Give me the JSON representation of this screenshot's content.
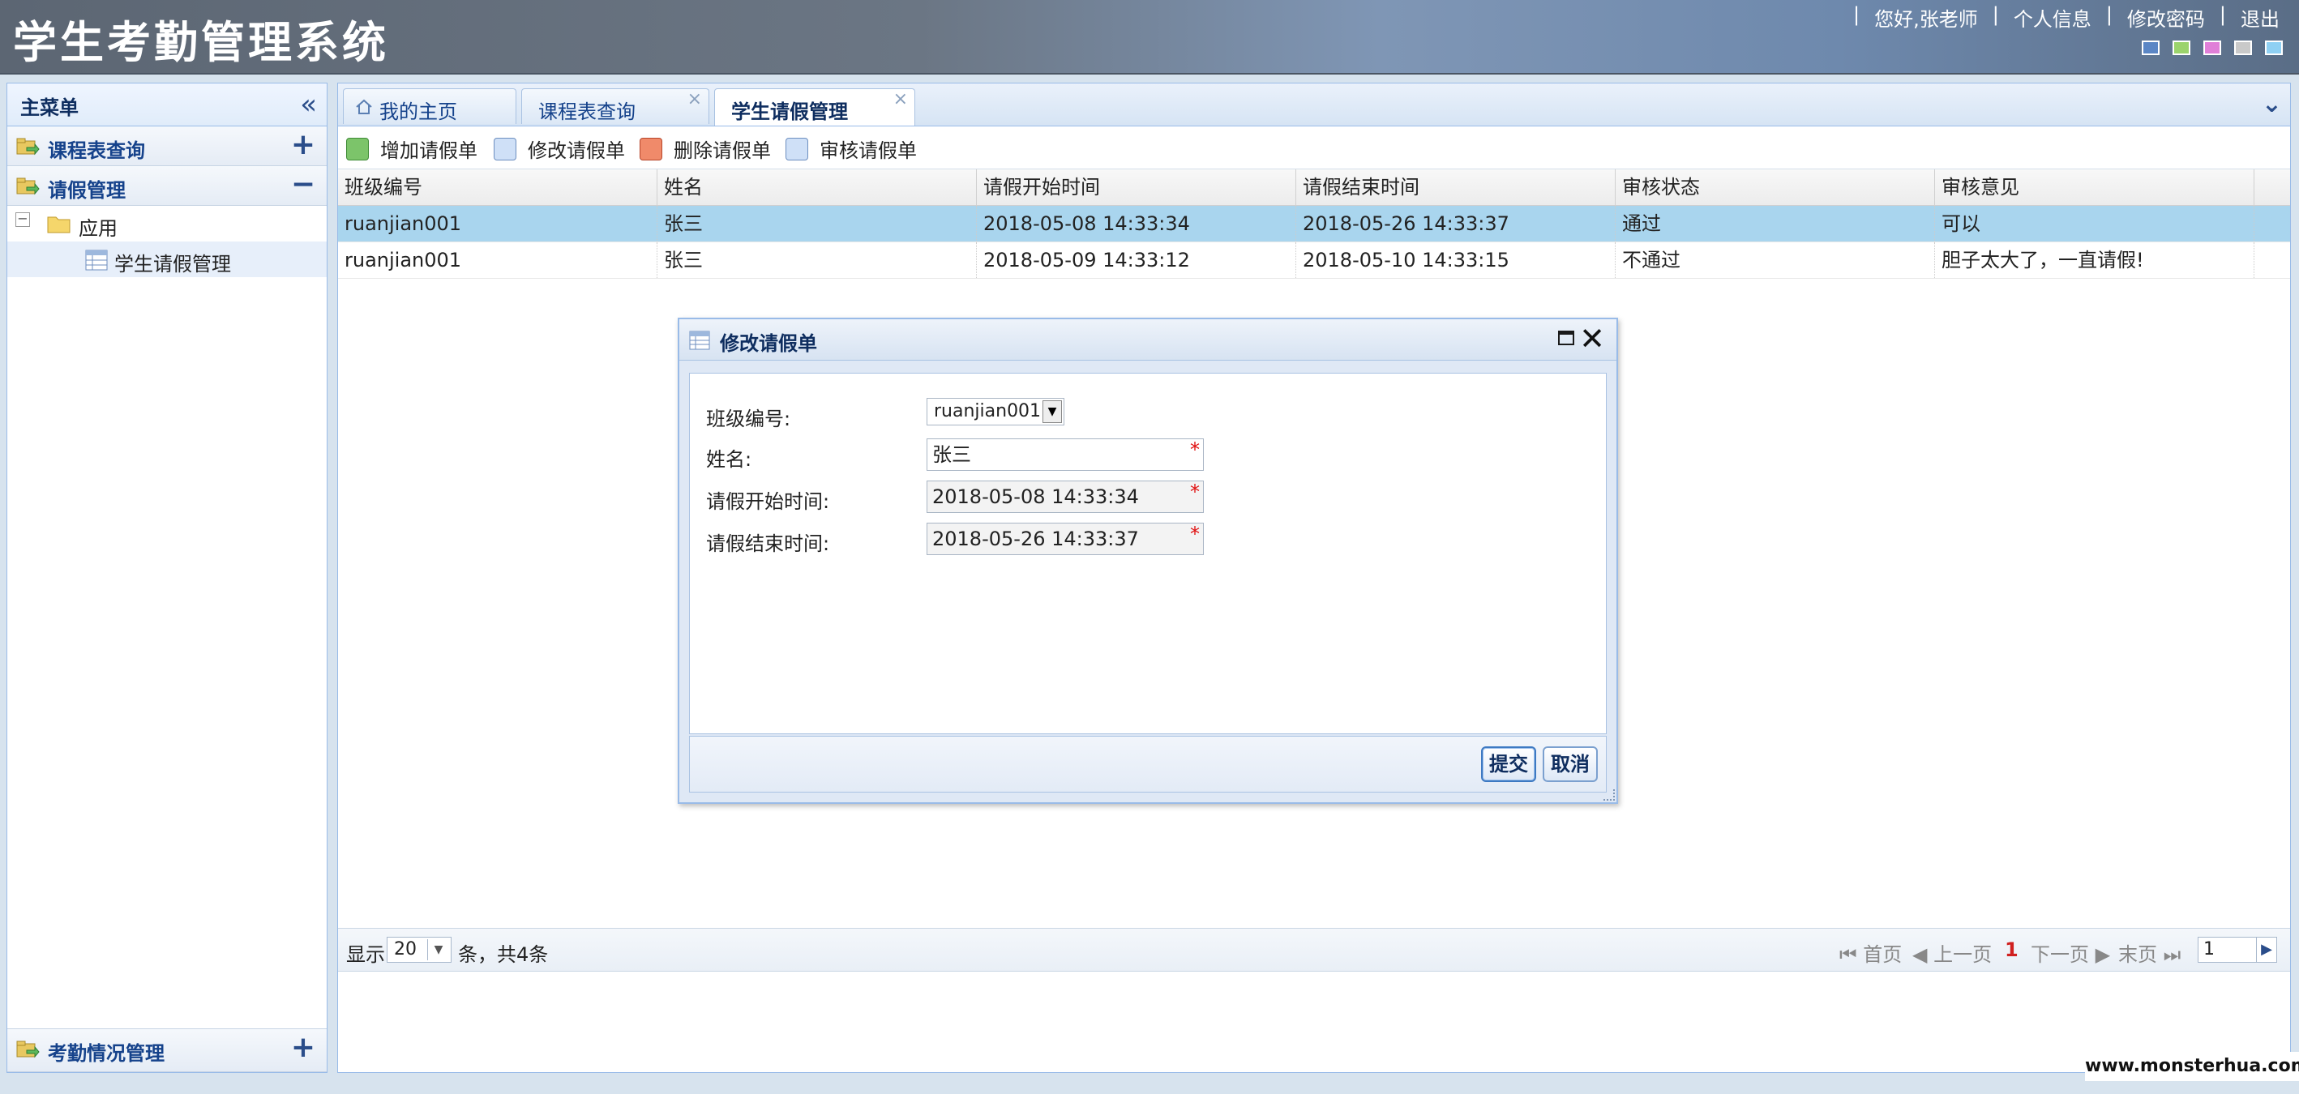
{
  "app": {
    "title": "学生考勤管理系统"
  },
  "top_links": {
    "greeting": "您好,张老师",
    "profile": "个人信息",
    "change_password": "修改密码",
    "logout": "退出"
  },
  "themes": [
    "#5b86c5",
    "#9bd36c",
    "#e07fd8",
    "#c9c9c9",
    "#8fd0f3"
  ],
  "sidebar": {
    "title": "主菜单",
    "sections": [
      {
        "label": "课程表查询",
        "toggle": "+"
      },
      {
        "label": "请假管理",
        "toggle": "−"
      }
    ],
    "tree": {
      "folder": "应用",
      "leaf": "学生请假管理",
      "expander": "−"
    },
    "bottom_section": {
      "label": "考勤情况管理",
      "toggle": "+"
    }
  },
  "tabs": [
    {
      "label": "我的主页",
      "closable": false
    },
    {
      "label": "课程表查询",
      "closable": true
    },
    {
      "label": "学生请假管理",
      "closable": true,
      "active": true
    }
  ],
  "toolbar": {
    "add": "增加请假单",
    "edit": "修改请假单",
    "delete": "删除请假单",
    "review": "审核请假单"
  },
  "grid": {
    "columns": [
      "班级编号",
      "姓名",
      "请假开始时间",
      "请假结束时间",
      "审核状态",
      "审核意见"
    ],
    "rows": [
      [
        "ruanjian001",
        "张三",
        "2018-05-08 14:33:34",
        "2018-05-26 14:33:37",
        "通过",
        "可以"
      ],
      [
        "ruanjian001",
        "张三",
        "2018-05-09 14:33:12",
        "2018-05-10 14:33:15",
        "不通过",
        "胆子太大了，一直请假!"
      ]
    ],
    "selected_row": 0
  },
  "pager": {
    "show_label": "显示",
    "page_size": "20",
    "total_label": "条，共4条",
    "first": "首页",
    "prev": "上一页",
    "current": "1",
    "next": "下一页",
    "last": "末页",
    "page_input": "1"
  },
  "dialog": {
    "title": "修改请假单",
    "fields": {
      "class_label": "班级编号:",
      "class_value": "ruanjian001",
      "name_label": "姓名:",
      "name_value": "张三",
      "start_label": "请假开始时间:",
      "start_value": "2018-05-08 14:33:34",
      "end_label": "请假结束时间:",
      "end_value": "2018-05-26 14:33:37",
      "required_mark": "*"
    },
    "submit": "提交",
    "cancel": "取消"
  },
  "watermark": "www.monsterhua.com"
}
